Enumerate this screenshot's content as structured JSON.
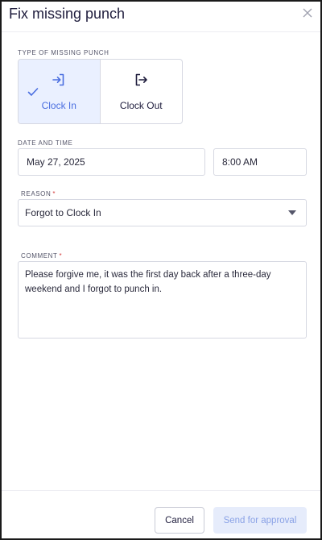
{
  "dialog": {
    "title": "Fix missing punch",
    "close_icon": "close-icon"
  },
  "punch_type": {
    "label": "TYPE OF MISSING PUNCH",
    "options": [
      {
        "label": "Clock In",
        "icon": "clock-in-icon",
        "selected": true
      },
      {
        "label": "Clock Out",
        "icon": "clock-out-icon",
        "selected": false
      }
    ]
  },
  "datetime": {
    "label": "DATE AND TIME",
    "date_value": "May 27, 2025",
    "time_value": "8:00 AM"
  },
  "reason": {
    "label": "REASON",
    "required_mark": "*",
    "selected_value": "Forgot to Clock In"
  },
  "comment": {
    "label": "COMMENT",
    "required_mark": "*",
    "value": "Please forgive me, it was the first day back after a three-day weekend and I forgot to punch in."
  },
  "footer": {
    "cancel_label": "Cancel",
    "send_label": "Send for approval"
  },
  "colors": {
    "accent": "#4a6ee0",
    "selected_bg": "#eaf0ff",
    "required": "#d33a3a",
    "disabled_button_bg": "#e6ecfb"
  }
}
